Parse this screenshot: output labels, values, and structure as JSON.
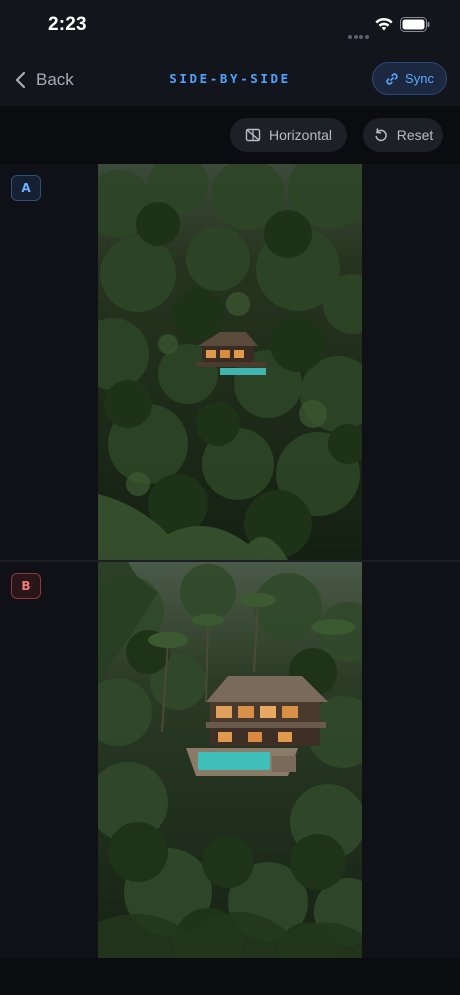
{
  "status": {
    "time": "2:23"
  },
  "nav": {
    "back_label": "Back",
    "title": "SIDE-BY-SIDE",
    "sync_label": "Sync"
  },
  "toolbar": {
    "orientation_label": "Horizontal",
    "reset_label": "Reset"
  },
  "panels": [
    {
      "badge": "A",
      "image": "jungle-villa-aerial-small"
    },
    {
      "badge": "B",
      "image": "jungle-villa-aerial-close"
    }
  ],
  "colors": {
    "accent": "#4da3ff",
    "badge_a": "#6fb1ff",
    "badge_b": "#f07b7f"
  }
}
